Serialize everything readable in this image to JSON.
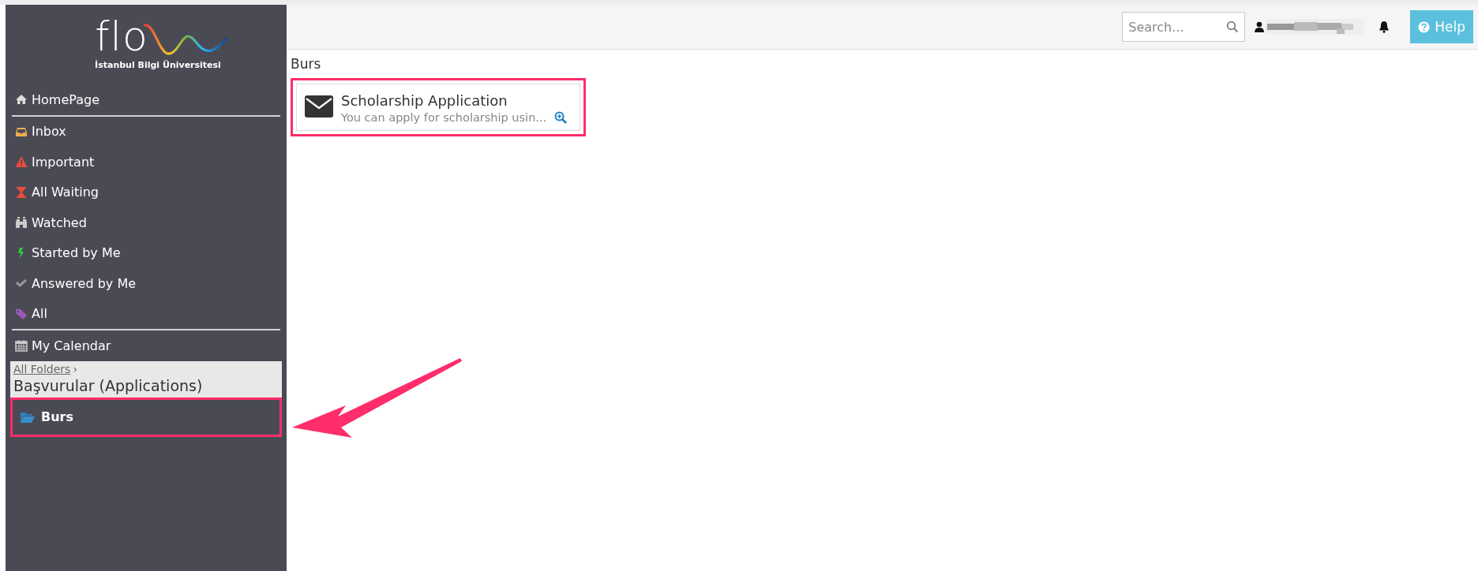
{
  "logo": {
    "wordmark": "flo",
    "subtitle": "İstanbul Bilgi Üniversitesi"
  },
  "menu_groups": [
    [
      {
        "label": "HomePage",
        "kind": "home"
      }
    ],
    [
      {
        "label": "Inbox",
        "kind": "inbox"
      },
      {
        "label": "Important",
        "kind": "warning"
      },
      {
        "label": "All Waiting",
        "kind": "hourglass"
      },
      {
        "label": "Watched",
        "kind": "binoculars"
      },
      {
        "label": "Started by Me",
        "kind": "bolt"
      },
      {
        "label": "Answered by Me",
        "kind": "check"
      },
      {
        "label": "All",
        "kind": "tag"
      }
    ],
    [
      {
        "label": "My Calendar",
        "kind": "calendar"
      }
    ]
  ],
  "folder_panel": {
    "breadcrumb_link": "All Folders",
    "breadcrumb_sep": "›",
    "current": "Başvurular (Applications)"
  },
  "folders": [
    {
      "label": "Burs",
      "selected": true,
      "highlighted": true
    }
  ],
  "header": {
    "search": {
      "placeholder": "Search..."
    },
    "help_button": "Help"
  },
  "content": {
    "title": "Burs",
    "cards": [
      {
        "title": "Scholarship Application",
        "description": "You can apply for scholarship usin...",
        "highlighted": true
      }
    ]
  },
  "annotation_arrow": true
}
